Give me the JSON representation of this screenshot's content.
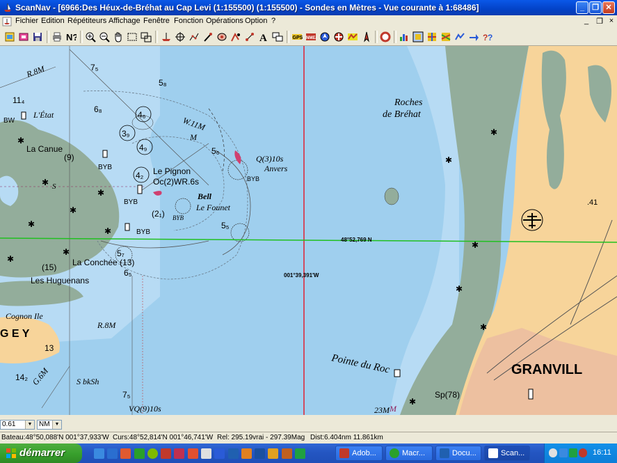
{
  "window": {
    "title": "ScanNav - [6966:Des Héux-de-Bréhat au Cap Levi (1:155500) (1:155500) - Sondes en  Mètres  - Vue courante à 1:68486]",
    "minimize": "_",
    "restore": "❐",
    "close": "✕"
  },
  "menu": {
    "items": [
      "Fichier",
      "Edition",
      "Répétiteurs",
      "Affichage",
      "Fenêtre",
      "Fonction",
      "Opérations",
      "Option",
      "?"
    ],
    "mdi_minimize": "_",
    "mdi_restore": "❐",
    "mdi_close": "×"
  },
  "toolbar": {
    "icons": [
      "new-chart-icon",
      "open-icon",
      "save-icon",
      "print-icon",
      "help-icon",
      "zoom-in-icon",
      "zoom-out-icon",
      "hand-pan-icon",
      "select-rect-icon",
      "zoom-window-icon",
      "boat-icon",
      "target-icon",
      "route-icon",
      "pen-icon",
      "mark-icon",
      "tracking-icon",
      "locate-icon",
      "text-icon",
      "layers-icon",
      "gps-icon",
      "nmea-icon",
      "anchor-watch-icon",
      "mob-icon",
      "autopilot-icon",
      "compass-icon",
      "lifebuoy-icon",
      "tide-icon",
      "instruments-icon",
      "grid-icon",
      "weather-icon",
      "wind-icon",
      "speed-icon",
      "log-icon"
    ],
    "text_tool": "A"
  },
  "chart": {
    "cursor_lat": "48°52,769 N",
    "cursor_lon": "001°39,391'W",
    "labels": {
      "roches": "Roches",
      "de_brehat": "de Bréhat",
      "pointe_du_roc": "Pointe du Roc",
      "granville": "GRANVILL",
      "l_etat": "L'État",
      "la_canue": "La Canue",
      "la_canue_num": "(9)",
      "le_pignon": "Le Pignon",
      "oc2": "Oc(2)WR.6s",
      "bell": "Bell",
      "le_founet": "Le Founet",
      "q3": "Q(3)10s",
      "anvers": "Anvers",
      "byb1": "BYB",
      "byb2": "BYB",
      "byb3": "BYB",
      "byb4": "BYB",
      "byb5": "BYB",
      "la_conchee": "La Conchée (13)",
      "les_huguenans": "Les Huguenans",
      "huguenans_num": "(15)",
      "cognon_ile": "Cognon Ile",
      "gey": "G E Y",
      "r8m_top": "R.8M",
      "r8m_mid": "R.8M",
      "w11m": "W.11M",
      "m": "M",
      "g6m": "G.6M",
      "s_bksh": "S bkSh",
      "vq9": "VQ(9)10s",
      "sp78": "Sp(78)",
      "bw": "BW",
      "s_mark": "S",
      "d41": ".41",
      "m_bottom": "M",
      "q23m": "23M"
    },
    "depths": [
      "7₅",
      "5₈",
      "6₈",
      "4₆",
      "3₉",
      "4₉",
      "4₂",
      "5₆",
      "(2₁)",
      "5₅",
      "5₇",
      "6₅",
      "13",
      "14₂",
      "11₄",
      "7₅"
    ],
    "circle_depths": [
      "4₆",
      "3₉",
      "4₉",
      "4₂"
    ]
  },
  "controls": {
    "scale_value": "0.61",
    "unit_value": "NM"
  },
  "status": {
    "bateau": "Bateau:48°50,088'N 001°37,933'W",
    "curs": "Curs:48°52,814'N 001°46,741'W",
    "rel": "Rel: 295.19vrai - 297.39Mag",
    "dist": "Dist:6.404nm  11.861km"
  },
  "taskbar": {
    "start_label": "démarrer",
    "tasks": [
      "Adob...",
      "Macr...",
      "Docu...",
      "Scan..."
    ],
    "clock": "16:11"
  }
}
